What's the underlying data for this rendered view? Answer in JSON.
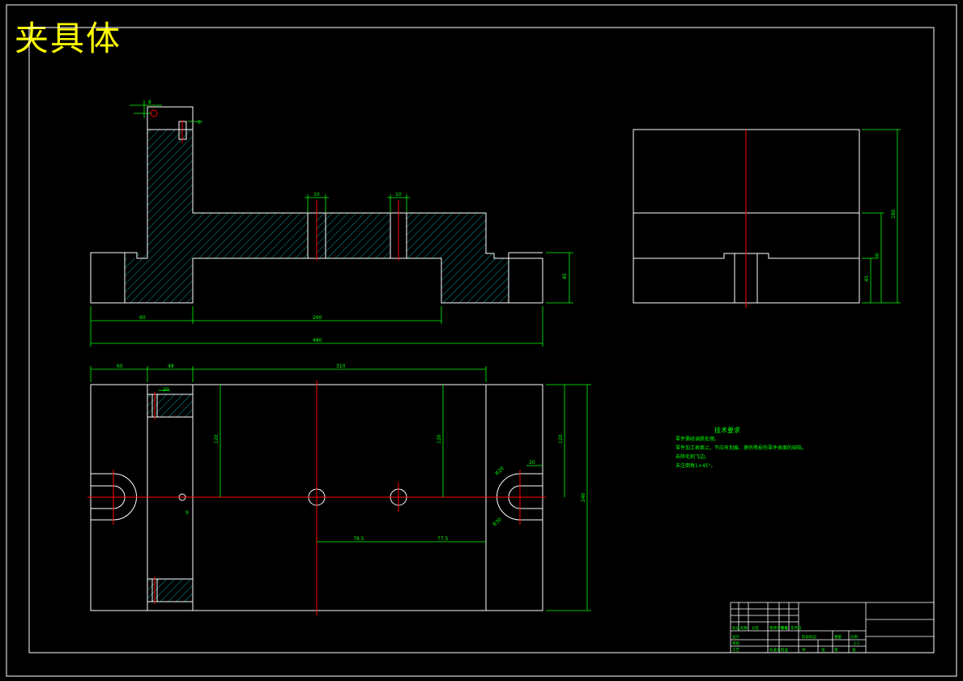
{
  "drawing": {
    "title": "夹具体",
    "colors": {
      "background": "#000000",
      "outline": "#ffffff",
      "dimension": "#00ff00",
      "centerline": "#ff0000",
      "hatch": "#00c8c8",
      "title": "#ffff00"
    },
    "dimensions": {
      "front_left": "60",
      "front_mid": "260",
      "front_total": "480",
      "front_height": "45",
      "slot1": "10",
      "slot2": "10",
      "top_small1": "8",
      "top_small2": "6",
      "side_total": "180",
      "side_upper": "90",
      "side_lower": "45",
      "plan_top1": "60",
      "plan_top2": "48",
      "plan_top3": "310",
      "plan_left_v": "120",
      "plan_right_v": "120",
      "plan_right_outer_v": "120",
      "plan_total_v": "240",
      "plan_hole_h1": "78.5",
      "plan_hole_h2": "77.5",
      "plan_slot_w": "20",
      "plan_r1": "R20",
      "plan_r2": "R30",
      "plan_small": "9",
      "plan_small2": "20"
    },
    "tech_requirements": {
      "heading": "技术要求",
      "lines": [
        "零件需经调质处理。",
        "零件加工表面上，不应有划痕、擦伤等损伤零件表面的缺陷。",
        "去除毛刺飞边。",
        "未注倒角1×45°。"
      ]
    },
    "title_block": {
      "cells": [
        "标记",
        "处数",
        "分区",
        "更改文件号",
        "签名",
        "年月日",
        "设计",
        "审核",
        "工艺",
        "标准化",
        "批准",
        "阶段标记",
        "重量",
        "比例",
        "1:1",
        "共",
        "张",
        "第",
        "张"
      ]
    }
  }
}
